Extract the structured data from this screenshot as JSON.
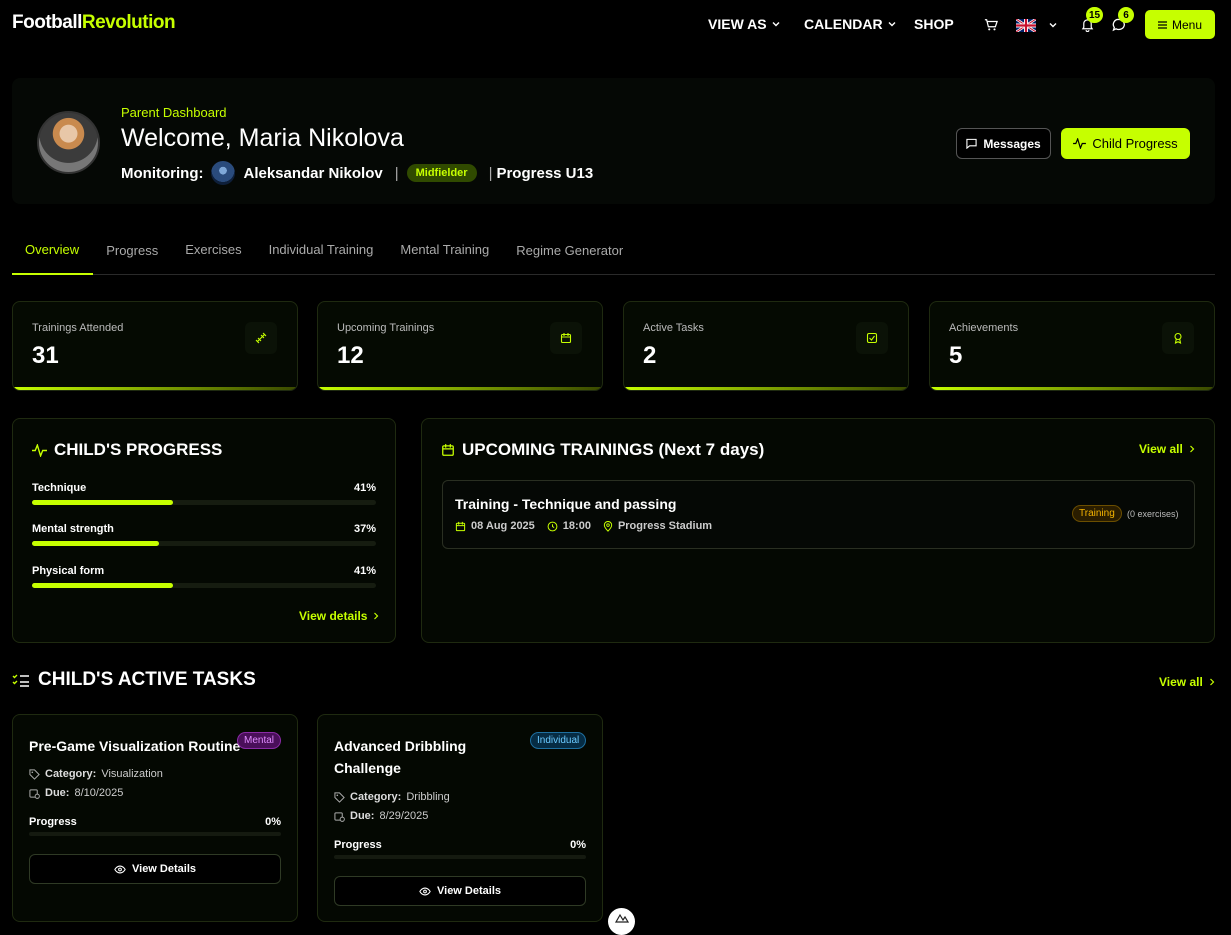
{
  "nav": {
    "logo_a": "Football",
    "logo_b": "Revolution",
    "links": [
      "VIEW AS",
      "CALENDAR",
      "SHOP"
    ],
    "notif_count": "15",
    "msg_count": "6",
    "menu_label": "Menu"
  },
  "hero": {
    "kicker": "Parent Dashboard",
    "welcome": "Welcome, Maria Nikolova",
    "monitoring_label": "Monitoring:",
    "child_name": "Aleksandar Nikolov",
    "position": "Midfielder",
    "team": "Progress U13",
    "sep": "|",
    "messages_label": "Messages",
    "progress_label": "Child Progress"
  },
  "tabs": [
    "Overview",
    "Progress",
    "Exercises",
    "Individual Training",
    "Mental Training",
    "Regime Generator"
  ],
  "stats": [
    {
      "label": "Trainings Attended",
      "value": "31"
    },
    {
      "label": "Upcoming Trainings",
      "value": "12"
    },
    {
      "label": "Active Tasks",
      "value": "2"
    },
    {
      "label": "Achievements",
      "value": "5"
    }
  ],
  "child_progress": {
    "title": "CHILD'S PROGRESS",
    "items": [
      {
        "name": "Technique",
        "percent": "41%",
        "value": 0.41
      },
      {
        "name": "Mental strength",
        "percent": "37%",
        "value": 0.37
      },
      {
        "name": "Physical form",
        "percent": "41%",
        "value": 0.41
      }
    ],
    "link": "View details"
  },
  "upcoming": {
    "title": "UPCOMING TRAININGS (Next 7 days)",
    "link": "View all",
    "trainings": [
      {
        "title": "Training - Technique and passing",
        "date": "08 Aug 2025",
        "time": "18:00",
        "location": "Progress Stadium",
        "badge": "Training",
        "exercises": "(0 exercises)"
      }
    ]
  },
  "tasks": {
    "title": "CHILD'S ACTIVE TASKS",
    "link": "View all",
    "category_label": "Category:",
    "due_label": "Due:",
    "progress_label": "Progress",
    "button_label": "View Details",
    "items": [
      {
        "name": "Pre-Game Visualization Routine",
        "badge": "Mental",
        "category": "Visualization",
        "due": "8/10/2025",
        "percent": "0%"
      },
      {
        "name": "Advanced Dribbling Challenge",
        "badge": "Individual",
        "category": "Dribbling",
        "due": "8/29/2025",
        "percent": "0%"
      }
    ]
  },
  "colors": {
    "accent": "#c6ff00",
    "mental": "#a020c0",
    "individual": "#1e90d8",
    "training": "#f5b400"
  }
}
